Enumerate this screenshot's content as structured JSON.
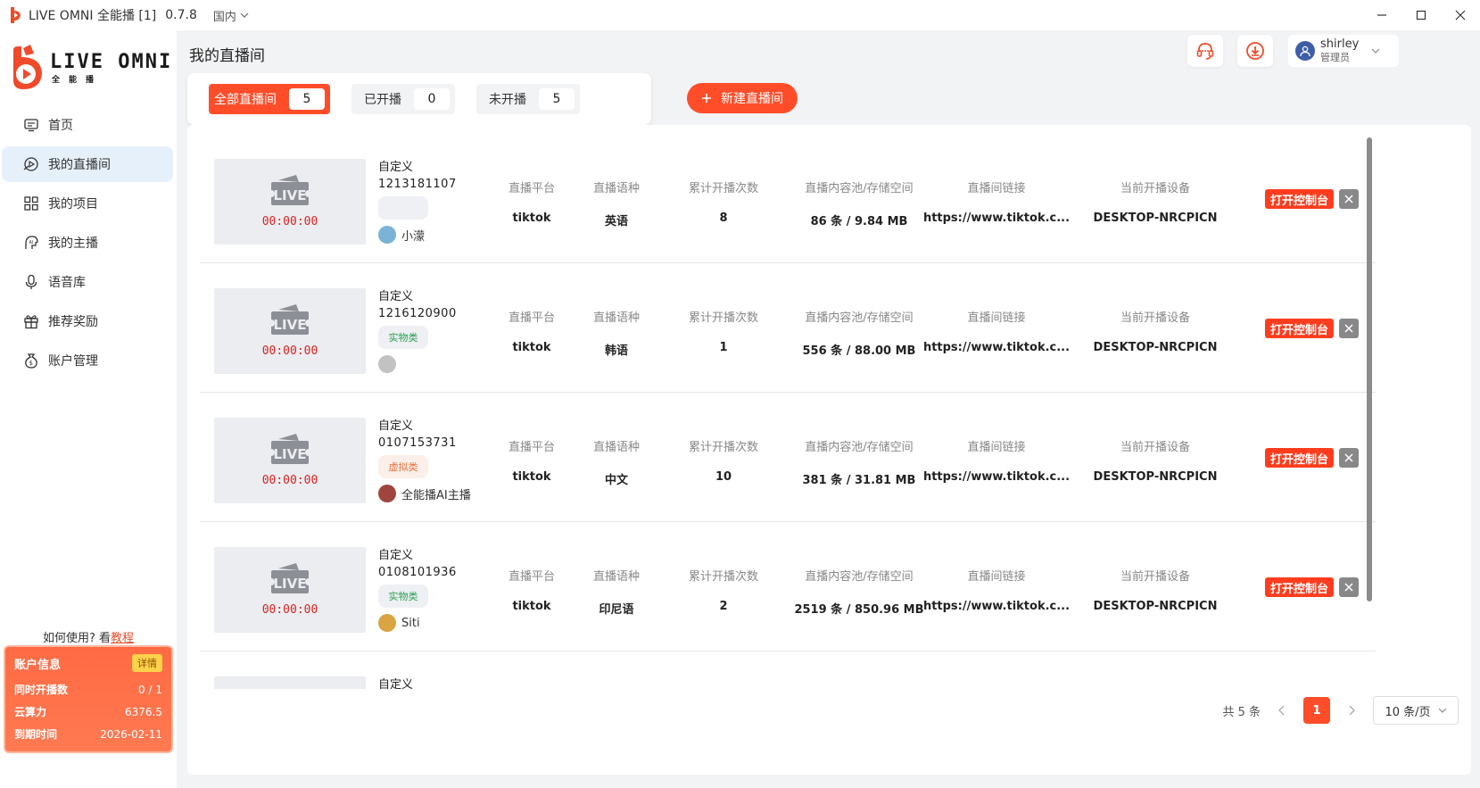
{
  "titlebar": {
    "app_title": "LIVE OMNI 全能播 [1]",
    "version": "0.7.8",
    "region": "国内"
  },
  "brand": {
    "name": "LIVE OMNI",
    "sub": "全能播"
  },
  "sidebar": {
    "items": [
      {
        "label": "首页",
        "icon": "home-icon"
      },
      {
        "label": "我的直播间",
        "icon": "live-room-icon"
      },
      {
        "label": "我的项目",
        "icon": "projects-icon"
      },
      {
        "label": "我的主播",
        "icon": "anchor-icon"
      },
      {
        "label": "语音库",
        "icon": "mic-icon"
      },
      {
        "label": "推荐奖励",
        "icon": "gift-icon"
      },
      {
        "label": "账户管理",
        "icon": "wallet-icon"
      }
    ],
    "howto_text": "如何使用? 看",
    "howto_link": "教程"
  },
  "account": {
    "title": "账户信息",
    "detail_label": "详情",
    "rows": [
      {
        "label": "同时开播数",
        "value": "0 / 1"
      },
      {
        "label": "云算力",
        "value": "6376.5"
      },
      {
        "label": "到期时间",
        "value": "2026-02-11"
      }
    ]
  },
  "header": {
    "page_title": "我的直播间",
    "user_name": "shirley",
    "user_role": "管理员"
  },
  "filters": [
    {
      "label": "全部直播间",
      "count": "5"
    },
    {
      "label": "已开播",
      "count": "0"
    },
    {
      "label": "未开播",
      "count": "5"
    }
  ],
  "new_room_label": "新建直播间",
  "columns": {
    "platform": "直播平台",
    "language": "直播语种",
    "count": "累计开播次数",
    "storage": "直播内容池/存储空间",
    "link": "直播间链接",
    "device": "当前开播设备"
  },
  "rooms": [
    {
      "name": "自定义",
      "id": "1213181107",
      "tag": "",
      "host": "小濛",
      "time": "00:00:00",
      "platform": "tiktok",
      "language": "英语",
      "count": "8",
      "storage": "86 条 / 9.84 MB",
      "link": "https://www.tiktok.c...",
      "device": "DESKTOP-NRCPICN"
    },
    {
      "name": "自定义",
      "id": "1216120900",
      "tag": "实物类",
      "host": "",
      "time": "00:00:00",
      "platform": "tiktok",
      "language": "韩语",
      "count": "1",
      "storage": "556 条 / 88.00 MB",
      "link": "https://www.tiktok.c...",
      "device": "DESKTOP-NRCPICN"
    },
    {
      "name": "自定义",
      "id": "0107153731",
      "tag": "虚拟类",
      "host": "全能播AI主播",
      "time": "00:00:00",
      "platform": "tiktok",
      "language": "中文",
      "count": "10",
      "storage": "381 条 / 31.81 MB",
      "link": "https://www.tiktok.c...",
      "device": "DESKTOP-NRCPICN"
    },
    {
      "name": "自定义",
      "id": "0108101936",
      "tag": "实物类",
      "host": "Siti",
      "time": "00:00:00",
      "platform": "tiktok",
      "language": "印尼语",
      "count": "2",
      "storage": "2519 条 / 850.96 MB",
      "link": "https://www.tiktok.c...",
      "device": "DESKTOP-NRCPICN"
    },
    {
      "name": "自定义"
    }
  ],
  "open_console_label": "打开控制台",
  "pager": {
    "total": "共 5 条",
    "current": "1",
    "page_size": "10 条/页"
  },
  "colors": {
    "accent": "#ff4d2a",
    "active_nav_bg": "#e6f0fa"
  }
}
